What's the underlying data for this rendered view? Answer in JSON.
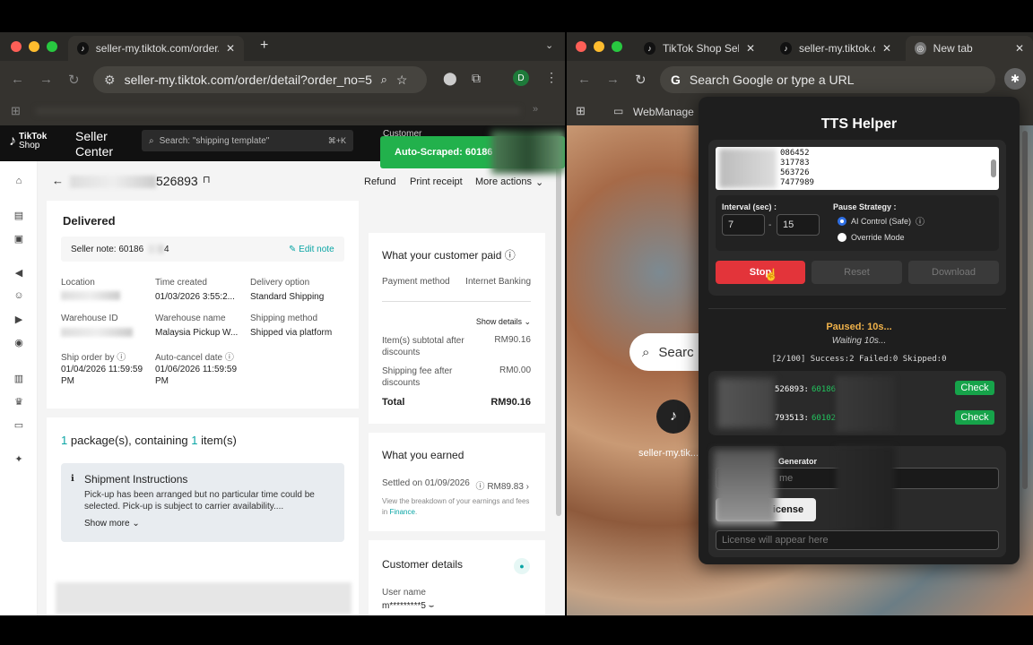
{
  "left_window": {
    "tabs": [
      {
        "label": "seller-my.tiktok.com/order/de"
      }
    ],
    "new_tab_symbol": "+",
    "url": "seller-my.tiktok.com/order/detail?order_no=5...",
    "avatar_letter": "D",
    "header": {
      "brand_tiktok": "TikTok",
      "brand_shop": "Shop",
      "seller_center_line1": "Seller",
      "seller_center_line2": "Center",
      "search_placeholder": "Search: \"shipping template\"",
      "shortcut": "⌘+K",
      "customer_label": "Customer"
    },
    "toast": "Auto-Scraped: 60186",
    "order_id_suffix": "526893",
    "actions": {
      "refund": "Refund",
      "print_receipt": "Print receipt",
      "more_actions": "More actions"
    },
    "order": {
      "status": "Delivered",
      "seller_note_label": "Seller note: 60186",
      "seller_note_tail": "4",
      "edit_note": "Edit note",
      "fields": [
        {
          "label": "Location",
          "value": ""
        },
        {
          "label": "Time created",
          "value": "01/03/2026 3:55:2..."
        },
        {
          "label": "Delivery option",
          "value": "Standard Shipping"
        },
        {
          "label": "Warehouse ID",
          "value": ""
        },
        {
          "label": "Warehouse name",
          "value": "Malaysia Pickup W..."
        },
        {
          "label": "Shipping method",
          "value": "Shipped via platform"
        },
        {
          "label": "Ship order by",
          "value": "01/04/2026 11:59:59 PM"
        },
        {
          "label": "Auto-cancel date",
          "value": "01/06/2026 11:59:59 PM"
        }
      ]
    },
    "package": {
      "count": "1",
      "text1": "package(s), containing",
      "items": "1",
      "text2": "item(s)",
      "instructions_title": "Shipment Instructions",
      "instructions_body": "Pick-up has been arranged but no particular time could be selected. Pick-up is subject to carrier availability....",
      "show_more": "Show more"
    },
    "payment": {
      "title": "What your customer paid",
      "method_label": "Payment method",
      "method_value": "Internet Banking",
      "show_details": "Show details",
      "subtotal_label": "Item(s) subtotal after discounts",
      "subtotal_value": "RM90.16",
      "shipping_label": "Shipping fee after discounts",
      "shipping_value": "RM0.00",
      "total_label": "Total",
      "total_value": "RM90.16"
    },
    "earned": {
      "title": "What you earned",
      "settled": "Settled on 01/09/2026",
      "amount": "RM89.83",
      "note": "View the breakdown of your earnings and fees in",
      "note_link": "Finance",
      "note_end": "."
    },
    "customer": {
      "title": "Customer details",
      "user_label": "User name",
      "user_value": "m*********5"
    }
  },
  "right_window": {
    "tabs": [
      {
        "label": "TikTok Shop Selle"
      },
      {
        "label": "seller-my.tiktok.c"
      },
      {
        "label": "New tab"
      }
    ],
    "omnibox": "Search Google or type a URL",
    "bookmark": "WebManage",
    "ntp_search": "Searc",
    "ntp_shortcut": "seller-my.tik...",
    "helper": {
      "title": "TTS Helper",
      "order_list": [
        "086452",
        "317783",
        "563726",
        "7477989"
      ],
      "interval_label": "Interval (sec) :",
      "interval_min": "7",
      "interval_sep": "-",
      "interval_max": "15",
      "pause_label": "Pause Strategy :",
      "pause_options": [
        {
          "label": "AI Control (Safe)",
          "selected": true
        },
        {
          "label": "Override Mode",
          "selected": false
        }
      ],
      "stop": "Stop",
      "reset": "Reset",
      "download": "Download",
      "status": "Paused: 10s...",
      "waiting": "Waiting 10s...",
      "progress": "[2/100] Success:2 Failed:0 Skipped:0",
      "results": [
        {
          "id": "526893:",
          "val": "60186",
          "action": "Check"
        },
        {
          "id": "793513:",
          "val": "60102",
          "action": "Check"
        }
      ],
      "generator_title": "Generator",
      "name_placeholder": "me",
      "license_btn": "icense",
      "license_placeholder": "License will appear here"
    }
  },
  "colors": {
    "accent_red": "#e3343a",
    "green": "#16a34a",
    "teal": "#0aa5a5",
    "toast": "#22b14c",
    "status_orange": "#f0b24a"
  }
}
